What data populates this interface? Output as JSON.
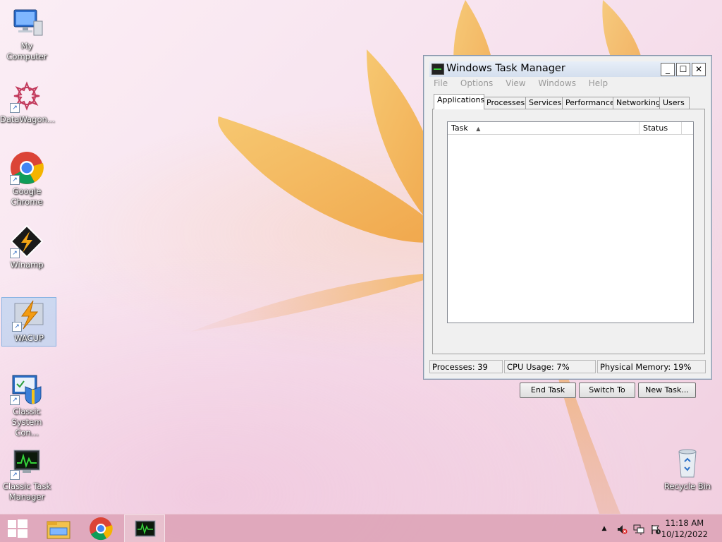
{
  "desktop": {
    "icons": [
      {
        "label": "My Computer"
      },
      {
        "label": "DataWagon..."
      },
      {
        "label": "Google Chrome"
      },
      {
        "label": "Winamp"
      },
      {
        "label": "WACUP"
      },
      {
        "label": "Classic System Con..."
      },
      {
        "label": "Classic Task Manager"
      },
      {
        "label": "Recycle Bin"
      }
    ]
  },
  "task_manager": {
    "title": "Windows Task Manager",
    "title_buttons": {
      "minimize": "_",
      "maximize": "☐",
      "close": "✕"
    },
    "menu": [
      "File",
      "Options",
      "View",
      "Windows",
      "Help"
    ],
    "tabs": [
      "Applications",
      "Processes",
      "Services",
      "Performance",
      "Networking",
      "Users"
    ],
    "active_tab": "Applications",
    "list": {
      "columns": [
        "Task",
        "Status"
      ],
      "sort_indicator": "▲",
      "rows": []
    },
    "buttons": {
      "end_task": "End Task",
      "switch_to": "Switch To",
      "new_task": "New Task..."
    },
    "status": {
      "processes": "Processes: 39",
      "cpu": "CPU Usage: 7%",
      "memory": "Physical Memory: 19%"
    }
  },
  "taskbar": {
    "clock_time": "11:18 AM",
    "clock_date": "10/12/2022",
    "tray_arrow": "▲"
  },
  "colors": {
    "wallpaper_pink": "#f7e2ee",
    "petal_orange": "#f2b24a",
    "taskbar": "#dea4b8"
  }
}
